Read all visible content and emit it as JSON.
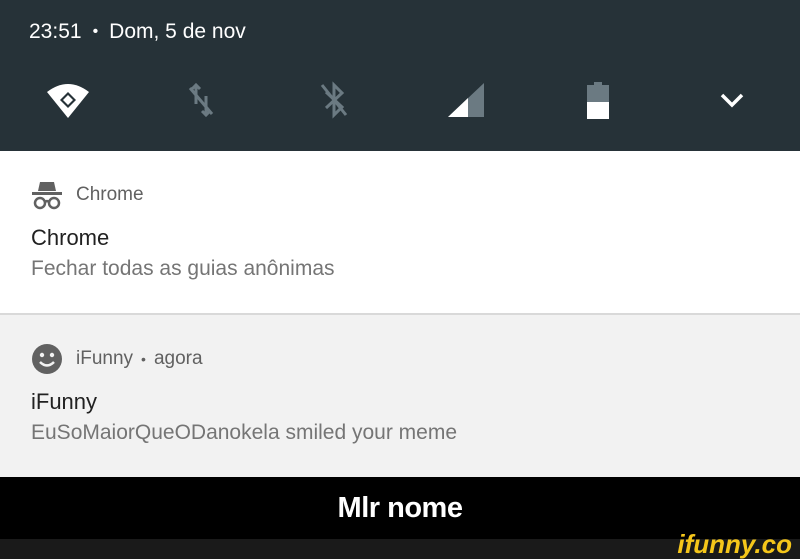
{
  "status_bar": {
    "time": "23:51",
    "separator": "•",
    "date": "Dom, 5 de nov"
  },
  "quick_settings": [
    {
      "icon": "wifi-icon",
      "state": "on"
    },
    {
      "icon": "mobile-data-off-icon",
      "state": "off"
    },
    {
      "icon": "bluetooth-off-icon",
      "state": "off"
    },
    {
      "icon": "signal-icon",
      "state": "partial"
    },
    {
      "icon": "battery-icon",
      "level": 0.45
    },
    {
      "icon": "chevron-down-icon",
      "state": "collapsed"
    }
  ],
  "notifications": [
    {
      "icon": "incognito-icon",
      "app": "Chrome",
      "title": "Chrome",
      "text": "Fechar todas as guias anônimas"
    },
    {
      "icon": "smiley-icon",
      "app": "iFunny",
      "separator": "•",
      "time": "agora",
      "title": "iFunny",
      "text": "EuSoMaiorQueODanokela smiled your meme"
    }
  ],
  "caption": "Mlr nome",
  "watermark": "ifunny.co",
  "colors": {
    "shade": "#263238",
    "card_white": "#ffffff",
    "card_grey": "#f2f2f2",
    "watermark": "#f5c61a"
  }
}
